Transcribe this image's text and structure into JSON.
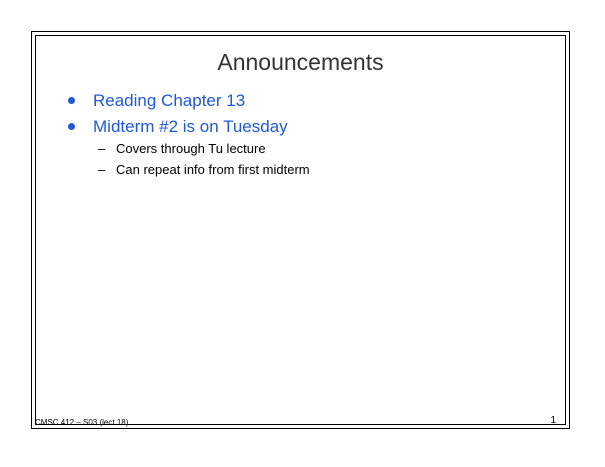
{
  "slide": {
    "title": "Announcements",
    "bullets": [
      {
        "text": "Reading Chapter 13"
      },
      {
        "text": "Midterm #2 is on Tuesday",
        "sub_bullets": [
          {
            "dash": "–",
            "text": "Covers through Tu lecture"
          },
          {
            "dash": "–",
            "text": "Can repeat info from first midterm"
          }
        ]
      }
    ],
    "footer_left": "CMSC 412 – S03 (lect 18)",
    "page_number": "1"
  },
  "colors": {
    "title": "#333333",
    "bullet_text": "#1f59d6",
    "sub_bullet_text": "#000000",
    "frame": "#000000",
    "background": "#ffffff"
  },
  "icons": {
    "bullet": "bullet-dot-icon",
    "sub_bullet": "dash-bullet-icon"
  }
}
